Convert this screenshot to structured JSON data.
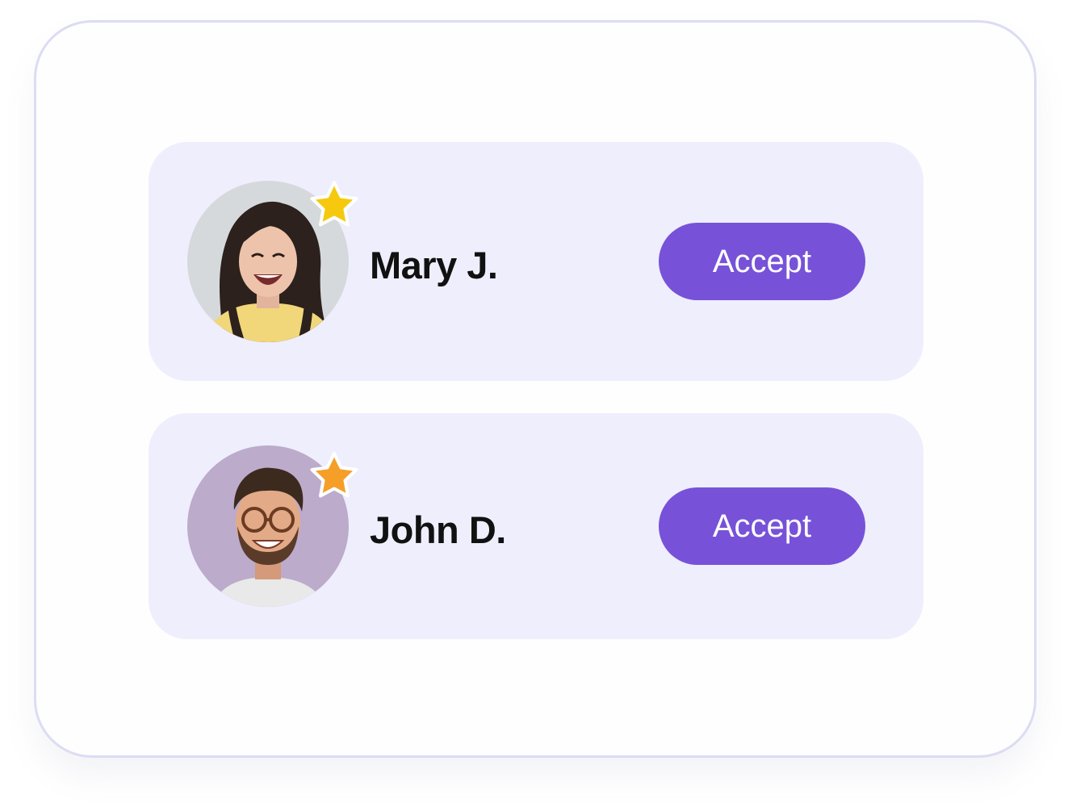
{
  "requests": [
    {
      "name": "Mary J.",
      "accept_label": "Accept",
      "star_color": "#f6c90e",
      "avatar_bg": "#d6d9dc",
      "avatar_icon": "avatar-photo-woman"
    },
    {
      "name": "John D.",
      "accept_label": "Accept",
      "star_color": "#f59f28",
      "avatar_bg": "#bcabcb",
      "avatar_icon": "avatar-photo-man"
    }
  ],
  "colors": {
    "card_bg": "#efeefd",
    "button_bg": "#7752d8",
    "frame_border": "#dcdcf4"
  }
}
